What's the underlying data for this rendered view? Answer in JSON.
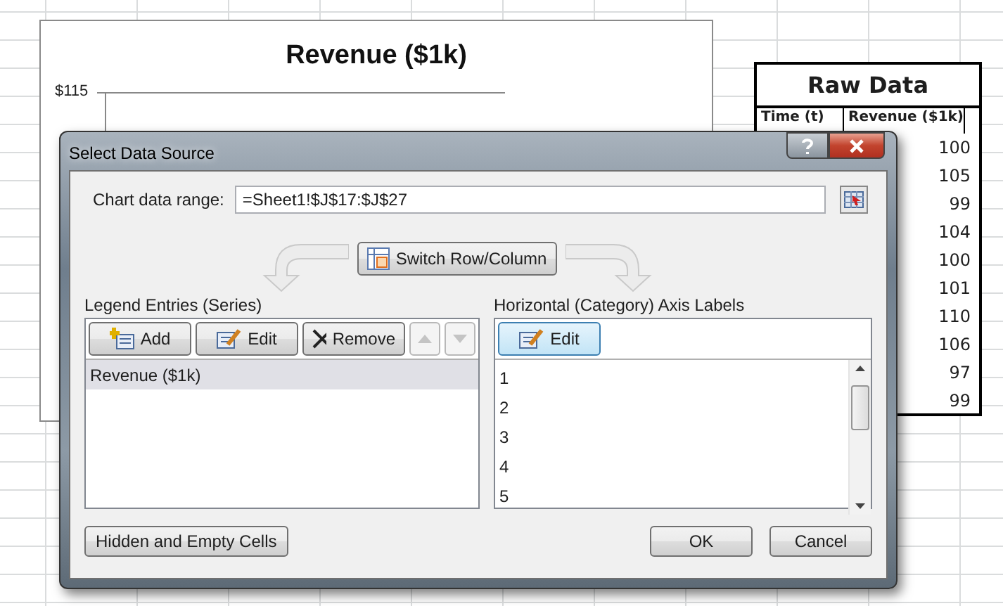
{
  "chart": {
    "title": "Revenue ($1k)",
    "axis_label": "$115"
  },
  "raw_data": {
    "title": "Raw Data",
    "columns": [
      "Time (t)",
      "Revenue ($1k)"
    ],
    "values": [
      "100",
      "105",
      "99",
      "104",
      "100",
      "101",
      "110",
      "106",
      "97",
      "99"
    ]
  },
  "dialog": {
    "title": "Select Data Source",
    "range_label": "Chart data range:",
    "range_value": "=Sheet1!$J$17:$J$27",
    "switch_button": "Switch Row/Column",
    "legend": {
      "label": "Legend Entries (Series)",
      "buttons": [
        {
          "kind": "add",
          "label": "Add",
          "disabled": false
        },
        {
          "kind": "edit",
          "label": "Edit",
          "disabled": false
        },
        {
          "kind": "remove",
          "label": "Remove",
          "disabled": false
        },
        {
          "kind": "up",
          "disabled": true
        },
        {
          "kind": "down",
          "disabled": true
        }
      ],
      "items": [
        {
          "label": "Revenue ($1k)",
          "selected": true
        }
      ]
    },
    "axis": {
      "label": "Horizontal (Category) Axis Labels",
      "edit_button": {
        "label": "Edit",
        "highlighted": true
      },
      "items": [
        "1",
        "2",
        "3",
        "4",
        "5"
      ]
    },
    "hidden_button": "Hidden and Empty Cells",
    "ok_button": "OK",
    "cancel_button": "Cancel"
  }
}
